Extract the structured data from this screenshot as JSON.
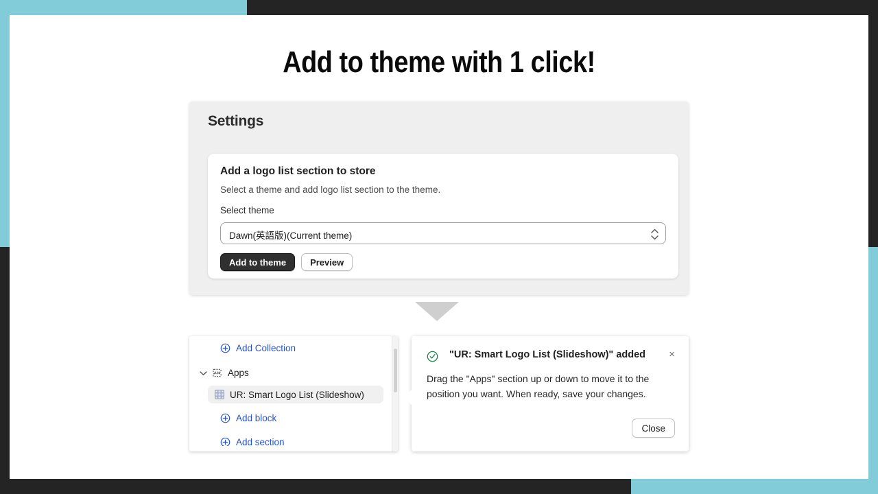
{
  "colors": {
    "accent_teal": "#82CBD8",
    "frame_dark": "#242424",
    "link_blue": "#2452d6",
    "primary_button": "#303030",
    "success_green": "#108043"
  },
  "slide": {
    "title": "Add to theme with 1 click!"
  },
  "settings_card": {
    "heading": "Settings",
    "inner": {
      "title": "Add a logo list section to store",
      "subtitle": "Select a theme and add logo list section to the theme.",
      "select_label": "Select theme",
      "select_value": "Dawn(英語版)(Current theme)",
      "select_options": [
        "Dawn(英語版)(Current theme)"
      ],
      "primary_button": "Add to theme",
      "secondary_button": "Preview"
    }
  },
  "arrow": {
    "icon": "triangle-down-icon"
  },
  "editor": {
    "sidebar": {
      "add_collection": "Add Collection",
      "apps_label": "Apps",
      "selected_block": "UR: Smart Logo List (Slideshow)",
      "add_block": "Add block",
      "cut_off_item": "Add section",
      "icons": {
        "add": "plus-circle-icon",
        "collapse": "chevron-down-icon",
        "section": "app-section-icon",
        "block": "grid-icon"
      }
    },
    "toast": {
      "title": "\"UR: Smart Logo List (Slideshow)\" added",
      "body": "Drag the \"Apps\" section up or down to move it to the position you want. When ready, save your changes.",
      "close_button": "Close",
      "close_icon": "×",
      "status_icon": "check-circle-icon"
    }
  }
}
